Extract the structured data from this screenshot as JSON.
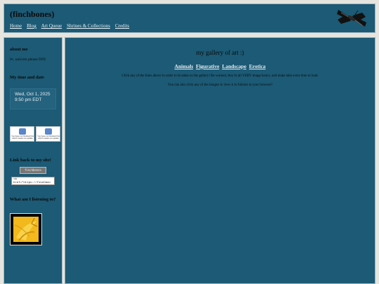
{
  "header": {
    "site_title": "(finchbones)",
    "nav": [
      "Home",
      "Blog",
      "Art Queue",
      "Shrines & Collections",
      "Credits"
    ]
  },
  "sidebar": {
    "about_heading": "about me",
    "about_text": "it•, unicorn please DNI",
    "time_heading": "My time and date",
    "clock_line1": "Wed, Oct 1, 2025",
    "clock_line2": "9:50 pm EDT",
    "broken_image_text": "You have not finished this which means an update",
    "link_heading": "Link back to my site!",
    "button_label": "finchbones",
    "code_text": "<a href=\"https://finchbon",
    "listening_heading": "What am I listening to?"
  },
  "main": {
    "title": "my gallery of art :)",
    "categories": [
      "Animals",
      "Figurative",
      "Landscape",
      "Erotica"
    ],
    "line1": "Click any of the links above in order to be taken to the gallery! Be warned, they're all VERY image heavy, and make take extra time to load.",
    "line2": "You can also click any of the images to view it in fullsize in your browser!"
  },
  "colors": {
    "panel": "#1c5a75",
    "page_bg": "#e6e4df",
    "link": "#e8eef2"
  }
}
